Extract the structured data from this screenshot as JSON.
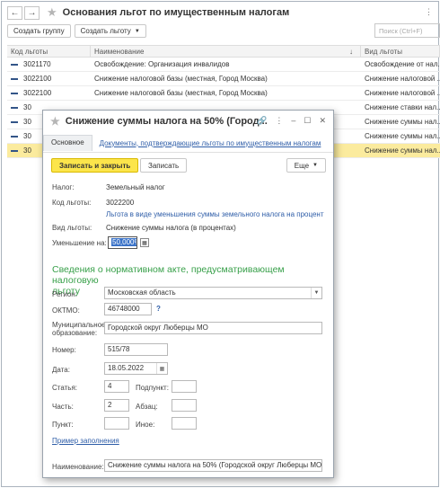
{
  "window": {
    "title": "Основания льгот по имущественным налогам",
    "nav_back": "←",
    "nav_forward": "→"
  },
  "toolbar": {
    "create_group": "Создать группу",
    "create_benefit": "Создать льготу",
    "search_placeholder": "Поиск (Ctrl+F)"
  },
  "grid": {
    "columns": [
      "Код льготы",
      "Наименование",
      "Вид льготы"
    ],
    "sort_arrow": "↓",
    "rows": [
      {
        "code": "3021170",
        "name": "Освобождение: Организация инвалидов",
        "kind": "Освобождение от нал..."
      },
      {
        "code": "3022100",
        "name": "Снижение налоговой базы (местная, Город Москва)",
        "kind": "Снижение налоговой ..."
      },
      {
        "code": "3022100",
        "name": "Снижение налоговой базы (местная, Город Москва)",
        "kind": "Снижение налоговой ..."
      },
      {
        "code": "30",
        "name": "",
        "kind": "Снижение ставки нал..."
      },
      {
        "code": "30",
        "name": "",
        "kind": "Снижение суммы нал..."
      },
      {
        "code": "30",
        "name": "",
        "kind": "Снижение суммы нал..."
      },
      {
        "code": "30",
        "name": "",
        "kind": "Снижение суммы нал..."
      }
    ]
  },
  "dialog": {
    "title": "Снижение суммы налога на 50% (Город...",
    "tab_main": "Основное",
    "tab_link": "Документы, подтверждающие льготы по имущественным налогам",
    "btn_save_close": "Записать и закрыть",
    "btn_save": "Записать",
    "btn_more": "Еще",
    "tax_label": "Налог:",
    "tax_value": "Земельный налог",
    "code_label": "Код льготы:",
    "code_value": "3022200",
    "code_hint": "Льгота в виде уменьшения суммы земельного налога на процент",
    "kind_label": "Вид льготы:",
    "kind_value": "Снижение суммы налога (в процентах)",
    "reduction_label": "Уменьшение на:",
    "reduction_value": "50,000%",
    "section_title_1": "Сведения о нормативном акте, предусматривающем налоговую",
    "section_title_2": "льготу",
    "region_label": "Регион:",
    "region_value": "Московская область",
    "oktmo_label": "ОКТМО:",
    "oktmo_value": "46748000",
    "oktmo_help": "?",
    "municipal_label_1": "Муниципальное",
    "municipal_label_2": "образование:",
    "municipal_value": "Городской округ Люберцы МО",
    "number_label": "Номер:",
    "number_value": "515/78",
    "date_label": "Дата:",
    "date_value": "18.05.2022",
    "article_label": "Статья:",
    "article_value": "4",
    "subpoint_label": "Подпункт:",
    "subpoint_value": "",
    "part_label": "Часть:",
    "part_value": "2",
    "paragraph_label": "Абзац:",
    "paragraph_value": "",
    "point_label": "Пункт:",
    "point_value": "",
    "other_label": "Иное:",
    "other_value": "",
    "example_link": "Пример заполнения",
    "name_label": "Наименование:",
    "name_value": "Снижение суммы налога на 50% (Городской округ Люберцы МО)"
  }
}
